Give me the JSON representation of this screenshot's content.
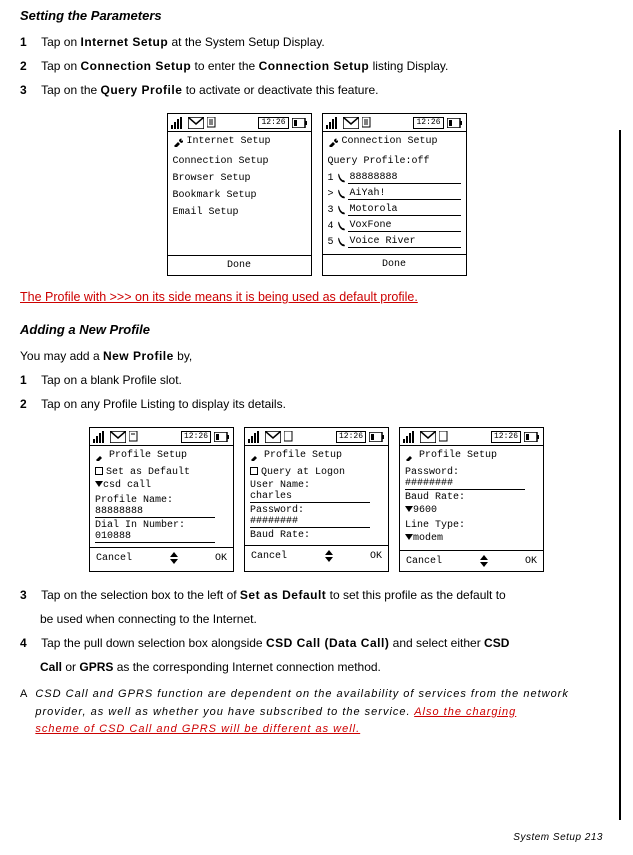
{
  "sectionA": {
    "title": "Setting the Parameters",
    "steps": [
      {
        "n": "1",
        "pre": "Tap on ",
        "b1": "Internet Setup",
        "post": " at the System   Setup Display."
      },
      {
        "n": "2",
        "pre": "Tap on ",
        "b1": "Connection Setup",
        "mid": " to enter the  ",
        "b2": "Connection Setup",
        "post": " listing Display."
      },
      {
        "n": "3",
        "pre": "Tap on the ",
        "b1": "Query Profile",
        "post": " to activate or deactivate this feature."
      }
    ]
  },
  "screen1": {
    "time": "12:26",
    "title": "Internet Setup",
    "items": [
      "Connection Setup",
      "Browser Setup",
      "Bookmark Setup",
      "Email Setup"
    ],
    "footer": "Done"
  },
  "screen2": {
    "time": "12:26",
    "title": "Connection Setup",
    "query": "Query Profile:off",
    "rows": [
      {
        "n": "1",
        "v": "88888888"
      },
      {
        "n": ">",
        "v": "AiYah!"
      },
      {
        "n": "3",
        "v": "Motorola"
      },
      {
        "n": "4",
        "v": "VoxFone"
      },
      {
        "n": "5",
        "v": "Voice River"
      }
    ],
    "footer": "Done"
  },
  "redline": "The Profile with >>> on its side means it is being used as default profile.",
  "sectionB": {
    "title": "Adding a New Profile",
    "intro_pre": "You may add a   ",
    "intro_b": "New Profile",
    "intro_post": " by,",
    "steps": [
      {
        "n": "1",
        "t": "Tap on a blank Profile slot."
      },
      {
        "n": "2",
        "t": "Tap on any Profile Listing to display its details."
      }
    ]
  },
  "screen3": {
    "time": "12:26",
    "title": "Profile Setup",
    "line1": "Set as Default",
    "line2": "csd call",
    "label1": "Profile Name:",
    "val1": "88888888",
    "label2": "Dial In Number:",
    "val2": "010888",
    "cancel": "Cancel",
    "ok": "OK"
  },
  "screen4": {
    "time": "12:26",
    "title": "Profile Setup",
    "line1": "Query at Logon",
    "label1": "User Name:",
    "val1": "charles",
    "label2": "Password:",
    "val2": "########",
    "label3": "Baud Rate:",
    "cancel": "Cancel",
    "ok": "OK"
  },
  "screen5": {
    "time": "12:26",
    "title": "Profile Setup",
    "label1": "Password:",
    "val1": "########",
    "label2": "Baud Rate:",
    "val2": "9600",
    "label3": "Line Type:",
    "val3": "modem",
    "cancel": "Cancel",
    "ok": "OK"
  },
  "steps2": [
    {
      "n": "3",
      "pre": "Tap on the selection box to the left of      ",
      "b": "Set as Default",
      "post": " to set this profile as the default to",
      "post2": "be used when connecting to the Internet."
    },
    {
      "n": "4",
      "pre": "Tap the pull down selection box alongside    ",
      "b": "CSD Call (Data Call)",
      "mid": "  and select either   ",
      "b2": "CSD",
      "post2_b": "Call",
      "mid2": " or ",
      "b3": "GPRS",
      "post3": " as the corresponding Internet connection method."
    }
  ],
  "note": {
    "mark": "A",
    "t1": "CSD Call and GPRS function are dependent on the availability of services from the network",
    "t2": "provider, as well as whether you have subscribed to the service.  ",
    "red": "Also the charging",
    "red2": "scheme of CSD Call and GPRS will be different as well."
  },
  "footer": "System Setup   213"
}
